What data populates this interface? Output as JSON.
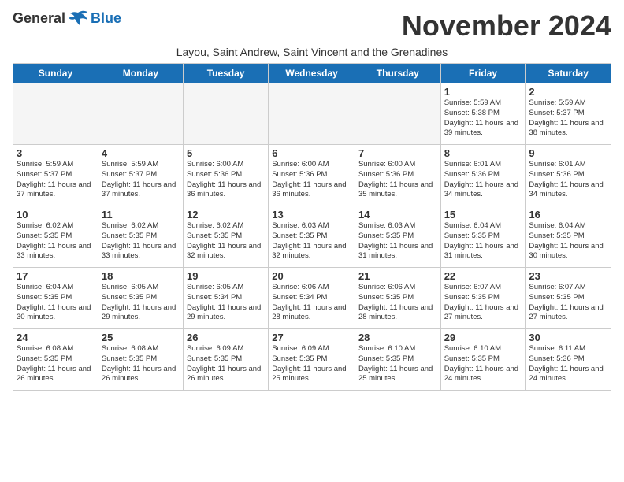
{
  "logo": {
    "general": "General",
    "blue": "Blue"
  },
  "title": "November 2024",
  "subtitle": "Layou, Saint Andrew, Saint Vincent and the Grenadines",
  "days_header": [
    "Sunday",
    "Monday",
    "Tuesday",
    "Wednesday",
    "Thursday",
    "Friday",
    "Saturday"
  ],
  "weeks": [
    [
      {
        "day": "",
        "info": ""
      },
      {
        "day": "",
        "info": ""
      },
      {
        "day": "",
        "info": ""
      },
      {
        "day": "",
        "info": ""
      },
      {
        "day": "",
        "info": ""
      },
      {
        "day": "1",
        "info": "Sunrise: 5:59 AM\nSunset: 5:38 PM\nDaylight: 11 hours and 39 minutes."
      },
      {
        "day": "2",
        "info": "Sunrise: 5:59 AM\nSunset: 5:37 PM\nDaylight: 11 hours and 38 minutes."
      }
    ],
    [
      {
        "day": "3",
        "info": "Sunrise: 5:59 AM\nSunset: 5:37 PM\nDaylight: 11 hours and 37 minutes."
      },
      {
        "day": "4",
        "info": "Sunrise: 5:59 AM\nSunset: 5:37 PM\nDaylight: 11 hours and 37 minutes."
      },
      {
        "day": "5",
        "info": "Sunrise: 6:00 AM\nSunset: 5:36 PM\nDaylight: 11 hours and 36 minutes."
      },
      {
        "day": "6",
        "info": "Sunrise: 6:00 AM\nSunset: 5:36 PM\nDaylight: 11 hours and 36 minutes."
      },
      {
        "day": "7",
        "info": "Sunrise: 6:00 AM\nSunset: 5:36 PM\nDaylight: 11 hours and 35 minutes."
      },
      {
        "day": "8",
        "info": "Sunrise: 6:01 AM\nSunset: 5:36 PM\nDaylight: 11 hours and 34 minutes."
      },
      {
        "day": "9",
        "info": "Sunrise: 6:01 AM\nSunset: 5:36 PM\nDaylight: 11 hours and 34 minutes."
      }
    ],
    [
      {
        "day": "10",
        "info": "Sunrise: 6:02 AM\nSunset: 5:35 PM\nDaylight: 11 hours and 33 minutes."
      },
      {
        "day": "11",
        "info": "Sunrise: 6:02 AM\nSunset: 5:35 PM\nDaylight: 11 hours and 33 minutes."
      },
      {
        "day": "12",
        "info": "Sunrise: 6:02 AM\nSunset: 5:35 PM\nDaylight: 11 hours and 32 minutes."
      },
      {
        "day": "13",
        "info": "Sunrise: 6:03 AM\nSunset: 5:35 PM\nDaylight: 11 hours and 32 minutes."
      },
      {
        "day": "14",
        "info": "Sunrise: 6:03 AM\nSunset: 5:35 PM\nDaylight: 11 hours and 31 minutes."
      },
      {
        "day": "15",
        "info": "Sunrise: 6:04 AM\nSunset: 5:35 PM\nDaylight: 11 hours and 31 minutes."
      },
      {
        "day": "16",
        "info": "Sunrise: 6:04 AM\nSunset: 5:35 PM\nDaylight: 11 hours and 30 minutes."
      }
    ],
    [
      {
        "day": "17",
        "info": "Sunrise: 6:04 AM\nSunset: 5:35 PM\nDaylight: 11 hours and 30 minutes."
      },
      {
        "day": "18",
        "info": "Sunrise: 6:05 AM\nSunset: 5:35 PM\nDaylight: 11 hours and 29 minutes."
      },
      {
        "day": "19",
        "info": "Sunrise: 6:05 AM\nSunset: 5:34 PM\nDaylight: 11 hours and 29 minutes."
      },
      {
        "day": "20",
        "info": "Sunrise: 6:06 AM\nSunset: 5:34 PM\nDaylight: 11 hours and 28 minutes."
      },
      {
        "day": "21",
        "info": "Sunrise: 6:06 AM\nSunset: 5:35 PM\nDaylight: 11 hours and 28 minutes."
      },
      {
        "day": "22",
        "info": "Sunrise: 6:07 AM\nSunset: 5:35 PM\nDaylight: 11 hours and 27 minutes."
      },
      {
        "day": "23",
        "info": "Sunrise: 6:07 AM\nSunset: 5:35 PM\nDaylight: 11 hours and 27 minutes."
      }
    ],
    [
      {
        "day": "24",
        "info": "Sunrise: 6:08 AM\nSunset: 5:35 PM\nDaylight: 11 hours and 26 minutes."
      },
      {
        "day": "25",
        "info": "Sunrise: 6:08 AM\nSunset: 5:35 PM\nDaylight: 11 hours and 26 minutes."
      },
      {
        "day": "26",
        "info": "Sunrise: 6:09 AM\nSunset: 5:35 PM\nDaylight: 11 hours and 26 minutes."
      },
      {
        "day": "27",
        "info": "Sunrise: 6:09 AM\nSunset: 5:35 PM\nDaylight: 11 hours and 25 minutes."
      },
      {
        "day": "28",
        "info": "Sunrise: 6:10 AM\nSunset: 5:35 PM\nDaylight: 11 hours and 25 minutes."
      },
      {
        "day": "29",
        "info": "Sunrise: 6:10 AM\nSunset: 5:35 PM\nDaylight: 11 hours and 24 minutes."
      },
      {
        "day": "30",
        "info": "Sunrise: 6:11 AM\nSunset: 5:36 PM\nDaylight: 11 hours and 24 minutes."
      }
    ]
  ]
}
